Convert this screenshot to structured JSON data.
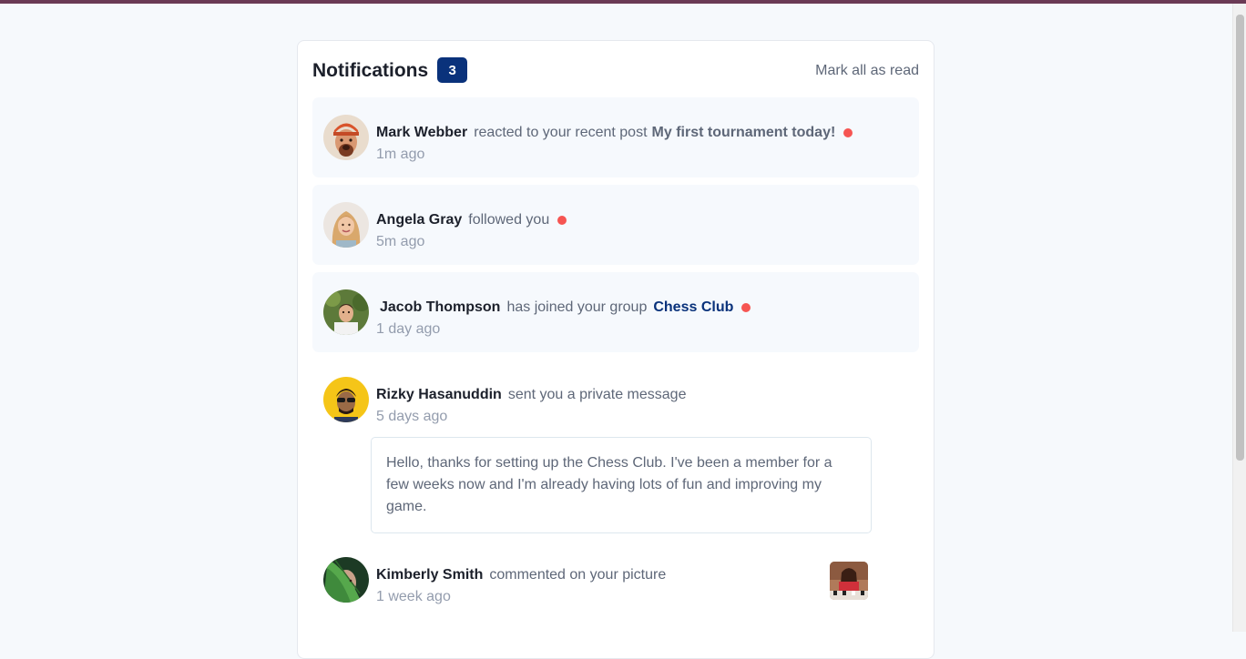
{
  "header": {
    "title": "Notifications",
    "unread_count": "3",
    "mark_all": "Mark all as read"
  },
  "notifications": [
    {
      "name": "Mark Webber",
      "action": "reacted to your recent post",
      "target": "My first tournament today!",
      "time": "1m ago",
      "unread": true,
      "avatar_icon": "avatar-mark-webber"
    },
    {
      "name": "Angela Gray",
      "action": "followed you",
      "time": "5m ago",
      "unread": true,
      "avatar_icon": "avatar-angela-gray"
    },
    {
      "name": "Jacob Thompson",
      "action": "has joined your group",
      "target": "Chess Club",
      "time": "1 day ago",
      "unread": true,
      "avatar_icon": "avatar-jacob-thompson"
    },
    {
      "name": "Rizky Hasanuddin",
      "action": "sent you a private message",
      "time": "5 days ago",
      "unread": false,
      "message": "Hello, thanks for setting up the Chess Club. I've been a member for a few weeks now and I'm already having lots of fun and improving my game.",
      "avatar_icon": "avatar-rizky-hasanuddin"
    },
    {
      "name": "Kimberly Smith",
      "action": "commented on your picture",
      "time": "1 week ago",
      "unread": false,
      "avatar_icon": "avatar-kimberly-smith",
      "picture_icon": "chess-picture-thumbnail"
    }
  ],
  "colors": {
    "accent": "#0a327b",
    "unread_dot": "#f65552",
    "unread_bg": "#f6f9fd",
    "page_bg": "#f6f9fc",
    "top_bar": "#6b3a55"
  }
}
